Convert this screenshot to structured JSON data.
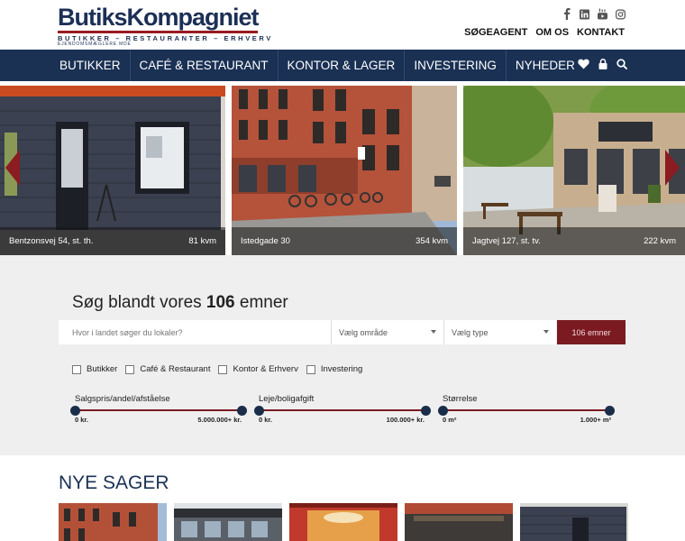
{
  "brand": {
    "name": "ButiksKompagniet",
    "tagline": "BUTIKKER – RESTAURANTER – ERHVERV",
    "subline": "EJENDOMSMÆGLERE MDE",
    "accent": "#7c1a22",
    "navy": "#1a3154"
  },
  "social": [
    "facebook-icon",
    "linkedin-icon",
    "youtube-icon",
    "instagram-icon"
  ],
  "top_links": [
    "SØGEAGENT",
    "OM OS",
    "KONTAKT"
  ],
  "nav": {
    "items": [
      "BUTIKKER",
      "CAFÉ & RESTAURANT",
      "KONTOR & LAGER",
      "INVESTERING",
      "NYHEDER"
    ],
    "icons": [
      "heart-icon",
      "lock-icon",
      "search-icon"
    ]
  },
  "slides": [
    {
      "address": "Bentzonsvej 54, st. th.",
      "size": "81 kvm"
    },
    {
      "address": "Istedgade 30",
      "size": "354 kvm"
    },
    {
      "address": "Jagtvej 127, st. tv.",
      "size": "222 kvm"
    }
  ],
  "search": {
    "title_prefix": "Søg blandt vores ",
    "count": "106",
    "title_suffix": " emner",
    "placeholder": "Hvor i landet søger du lokaler?",
    "area_select": "Vælg område",
    "type_select": "Vælg type",
    "button": "106 emner",
    "checkboxes": [
      "Butikker",
      "Café & Restaurant",
      "Kontor & Erhverv",
      "Investering"
    ],
    "ranges": [
      {
        "label": "Salgspris/andel/afståelse",
        "min": "0 kr.",
        "max": "5.000.000+ kr."
      },
      {
        "label": "Leje/boligafgift",
        "min": "0 kr.",
        "max": "100.000+ kr."
      },
      {
        "label": "Størrelse",
        "min": "0 m²",
        "max": "1.000+ m²"
      }
    ]
  },
  "new_cases": {
    "title": "NYE SAGER"
  }
}
